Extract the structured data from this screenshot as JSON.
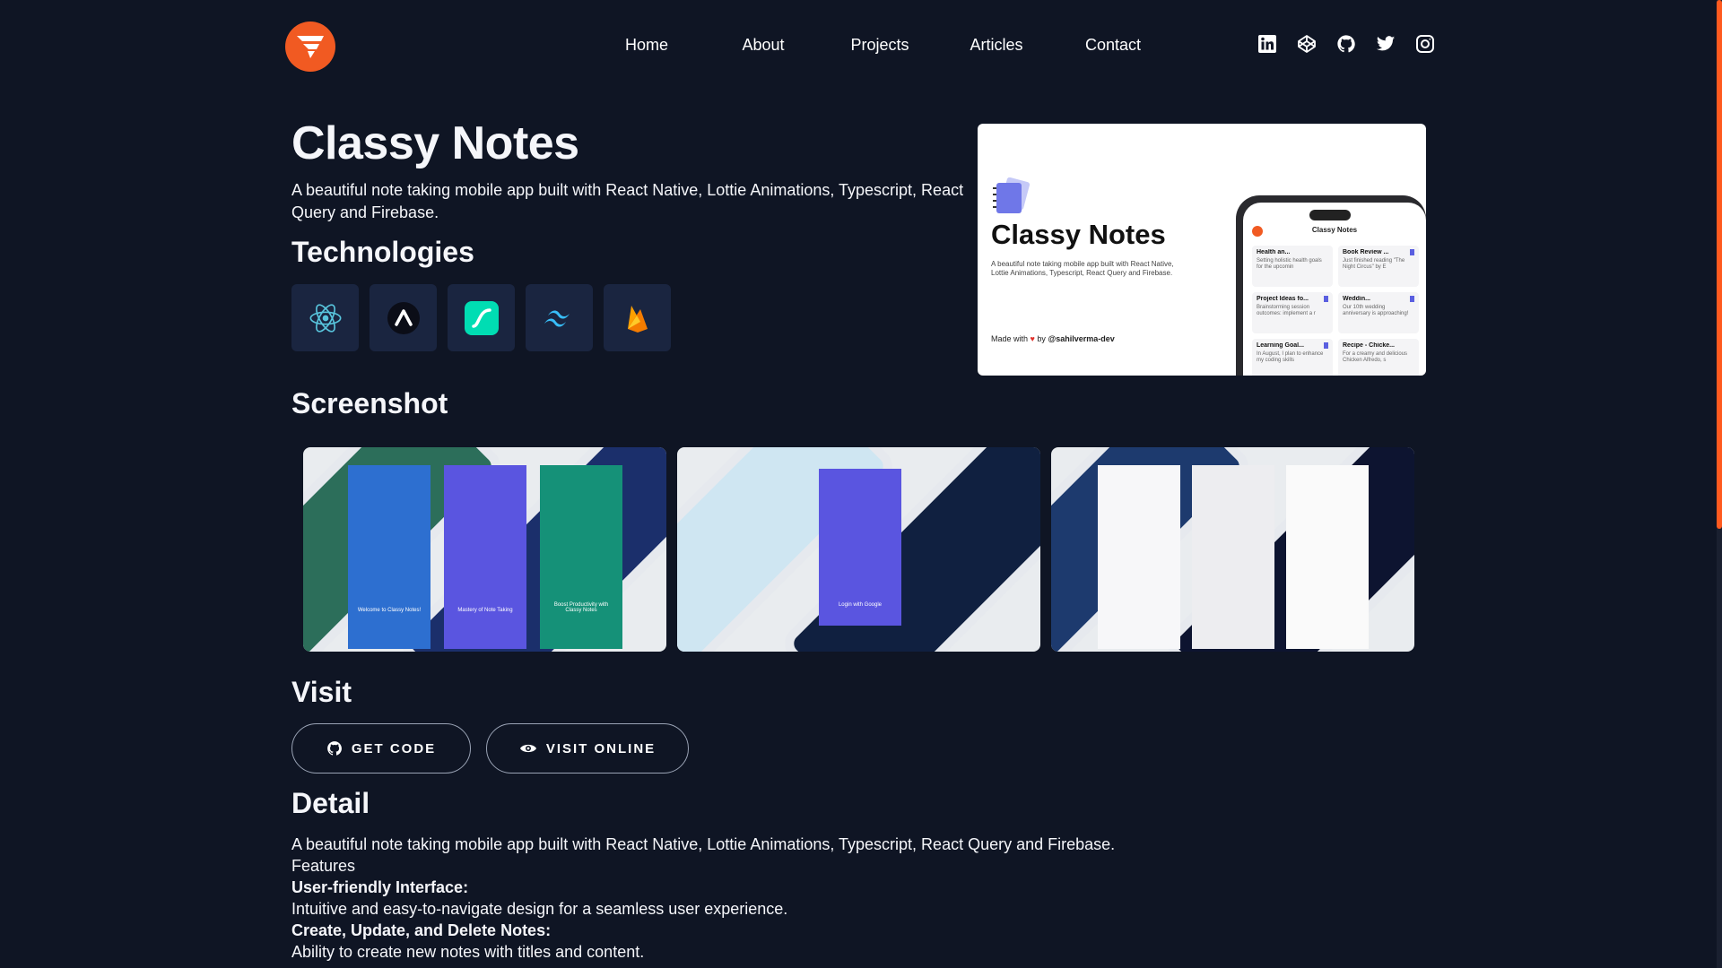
{
  "nav": {
    "items": [
      "Home",
      "About",
      "Projects",
      "Articles",
      "Contact"
    ],
    "socials": [
      "linkedin-icon",
      "codepen-icon",
      "github-icon",
      "twitter-icon",
      "instagram-icon"
    ]
  },
  "project": {
    "title": "Classy Notes",
    "description": "A beautiful note taking mobile app built with React Native, Lottie Animations, Typescript, React Query and Firebase."
  },
  "technologies": {
    "heading": "Technologies",
    "items": [
      "react-icon",
      "expo-icon",
      "lottie-icon",
      "tailwind-icon",
      "firebase-icon"
    ]
  },
  "cover": {
    "title": "Classy Notes",
    "description": "A beautiful note taking mobile app built with React Native, Lottie Animations, Typescript, React Query and Firebase.",
    "made_with": "Made with",
    "by": "by",
    "author": "@sahilverma-dev",
    "phone_header": "Classy Notes",
    "notes": [
      {
        "title": "Health an...",
        "desc": "Setting holistic health goals for the upcomin"
      },
      {
        "title": "Book Review ...",
        "desc": "Just finished reading \"The Night Circus\" by E"
      },
      {
        "title": "Project Ideas fo...",
        "desc": "Brainstorming session outcomes: implement a r"
      },
      {
        "title": "Weddin...",
        "desc": "Our 10th wedding anniversary is approaching!"
      },
      {
        "title": "Learning Goal...",
        "desc": "In August, I plan to enhance my coding skills"
      },
      {
        "title": "Recipe - Chicke...",
        "desc": "For a creamy and delicious Chicken Alfredo, s"
      }
    ]
  },
  "screenshots": {
    "heading": "Screenshot",
    "shot1_captions": [
      "Welcome to Classy Notes!",
      "Mastery of Note Taking",
      "Boost Productivity with Classy Notes"
    ],
    "shot2_caption": "Login with Google"
  },
  "visit": {
    "heading": "Visit",
    "get_code": "GET CODE",
    "visit_online": "VISIT ONLINE"
  },
  "detail": {
    "heading": "Detail",
    "intro": "A beautiful note taking mobile app built with React Native, Lottie Animations, Typescript, React Query and Firebase.",
    "features_label": "Features",
    "feature1_title": "User-friendly Interface:",
    "feature1_desc": "Intuitive and easy-to-navigate design for a seamless user experience.",
    "feature2_title": "Create, Update, and Delete Notes:",
    "feature2_desc": "Ability to create new notes with titles and content."
  },
  "colors": {
    "background": "#0f1524",
    "accent": "#f15a22",
    "tile": "#1a2540"
  }
}
